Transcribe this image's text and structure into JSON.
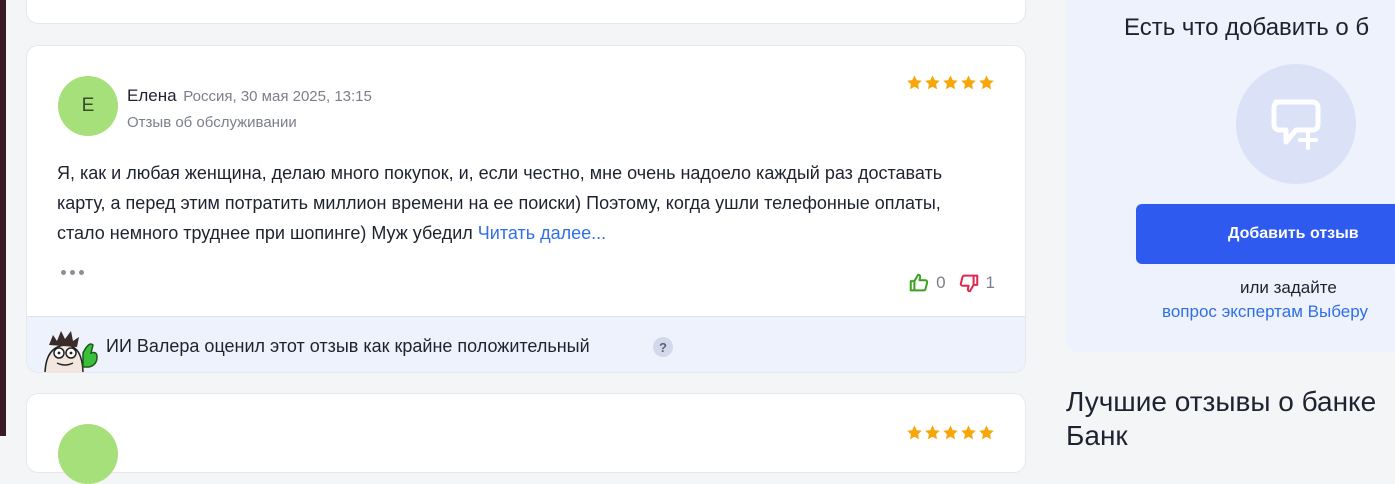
{
  "review": {
    "author_initial": "Е",
    "author_name": "Елена",
    "meta": "Россия, 30 мая 2025, 13:15",
    "type": "Отзыв об обслуживании",
    "rating": 5,
    "text": "Я, как и любая женщина, делаю много покупок, и, если честно, мне очень надоело каждый раз доставать карту, а перед этим потратить миллион времени на ее поиски) Поэтому, когда ушли телефонные оплаты, стало немного труднее при шопинге) Муж убедил ",
    "read_more": "Читать далее...",
    "likes": "0",
    "dislikes": "1",
    "ai_verdict": "ИИ Валера оценил этот отзыв как крайне положительный",
    "ai_help": "?"
  },
  "sidebar": {
    "title": "Есть что добавить о б",
    "add_button": "Добавить отзыв",
    "or_ask": "или задайте",
    "ask_link": "вопрос экспертам Выберу"
  },
  "best": {
    "title_line1": "Лучшие отзывы о банке",
    "title_line2": "Банк"
  },
  "colors": {
    "star": "#f7a70a",
    "like": "#3aa31e",
    "dislike": "#e0284e",
    "link": "#2f6fe8",
    "button": "#2f5af0"
  }
}
